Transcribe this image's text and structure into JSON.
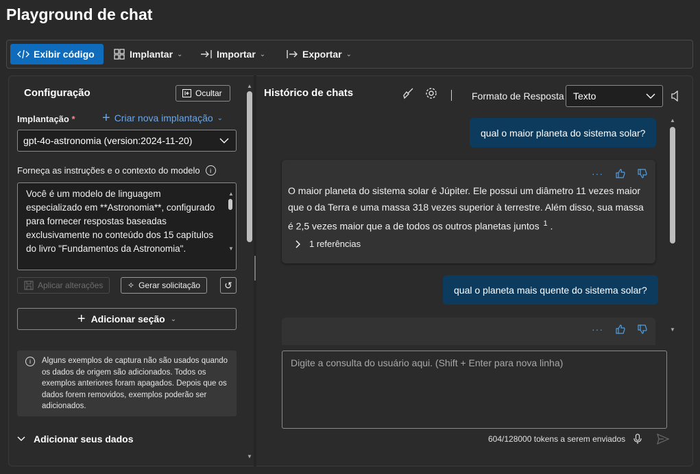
{
  "page": {
    "title": "Playground de chat"
  },
  "toolbar": {
    "view_code": "Exibir código",
    "deploy": "Implantar",
    "import": "Importar",
    "export": "Exportar"
  },
  "config": {
    "title": "Configuração",
    "hide": "Ocultar",
    "deployment_label": "Implantação",
    "required_mark": "*",
    "create_deployment": "Criar nova implantação",
    "deployment_value": "gpt-4o-astronomia (version:2024-11-20)",
    "instructions_label": "Forneça as instruções e o contexto do modelo",
    "instructions_text": "Você é um modelo de linguagem especializado em **Astronomia**, configurado para fornecer respostas baseadas exclusivamente no conteúdo dos 15 capítulos do livro \"Fundamentos da Astronomia\".",
    "apply_changes": "Aplicar alterações",
    "generate_prompt": "Gerar solicitação",
    "add_section": "Adicionar seção",
    "info_text": "Alguns exemplos de captura não são usados quando os dados de origem são adicionados. Todos os exemplos anteriores foram apagados. Depois que os dados forem removidos, exemplos poderão ser adicionados.",
    "add_data": "Adicionar seus dados"
  },
  "chat": {
    "title": "Histórico de chats",
    "response_format_label": "Formato de Resposta",
    "response_format_value": "Texto",
    "messages": [
      {
        "role": "user",
        "text": "qual o maior planeta do sistema solar?"
      },
      {
        "role": "assistant",
        "text": "O maior planeta do sistema solar é Júpiter. Ele possui um diâmetro 11 vezes maior que o da Terra e uma massa 318 vezes superior à terrestre. Além disso, sua massa é 2,5 vezes maior que a de todos os outros planetas juntos",
        "citation": "1",
        "references": "1 referências"
      },
      {
        "role": "user",
        "text": "qual o planeta mais quente do sistema solar?"
      }
    ],
    "more_actions": "···",
    "input_placeholder": "Digite a consulta do usuário aqui. (Shift + Enter para nova linha)",
    "token_count": "604/128000 tokens a serem enviados"
  }
}
